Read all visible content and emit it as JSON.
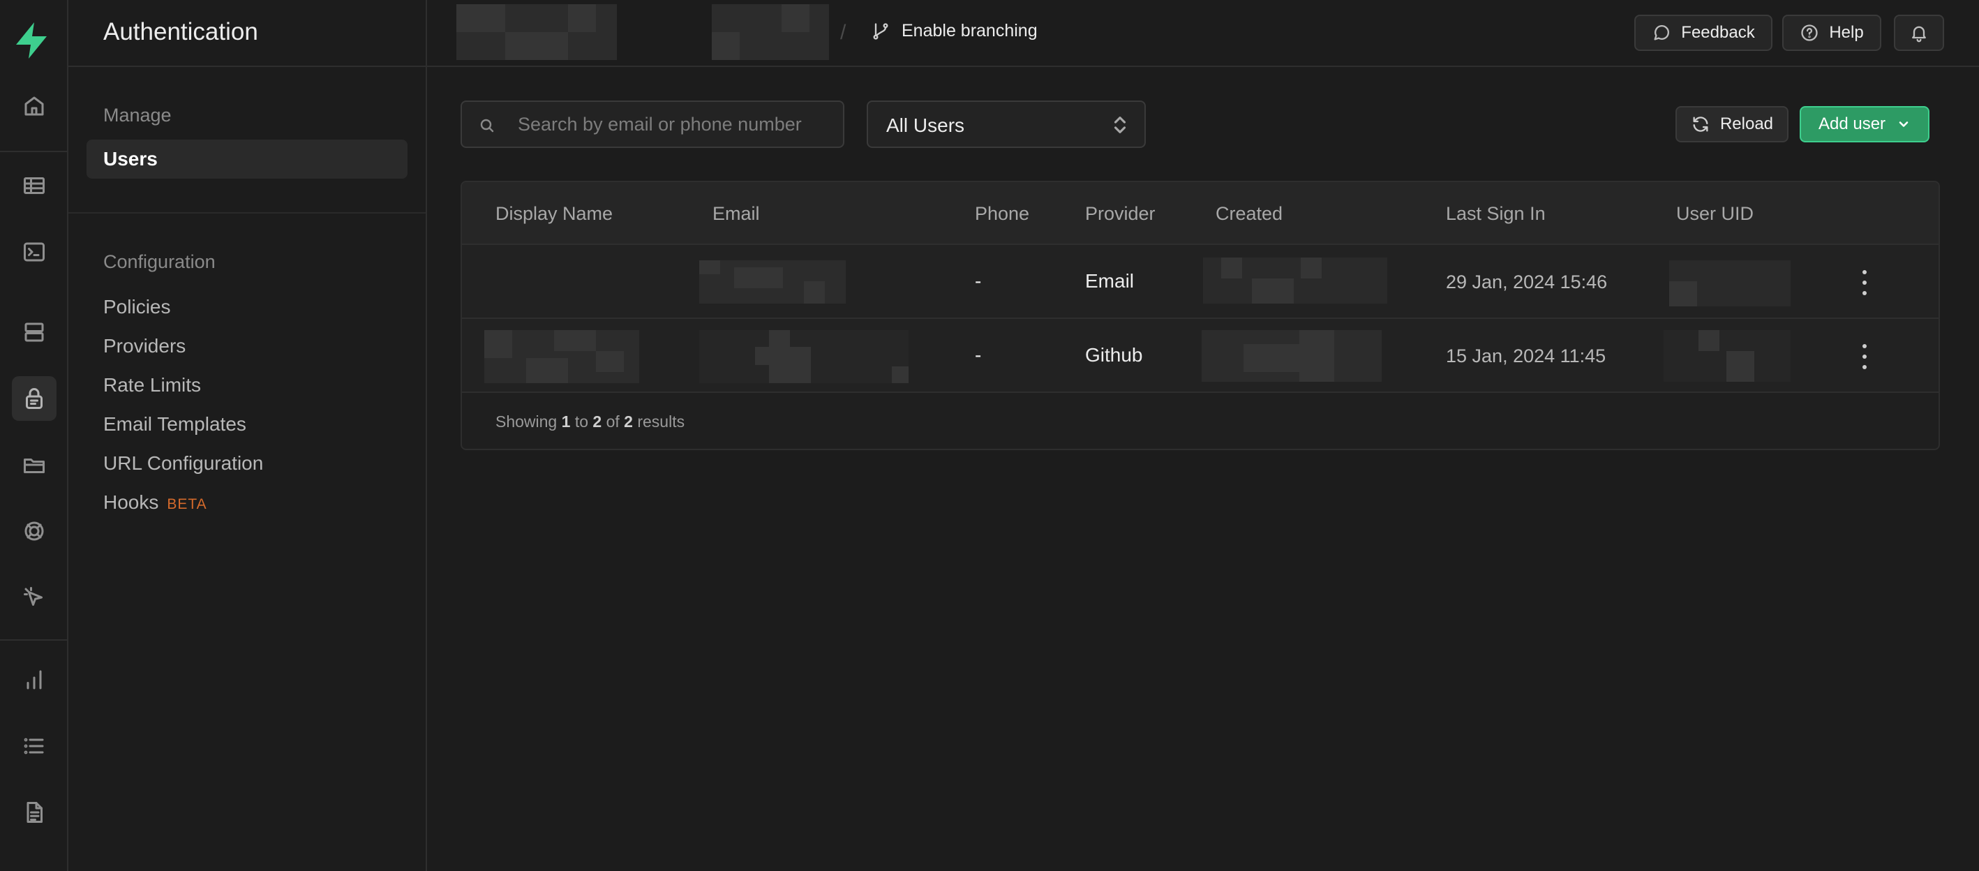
{
  "app": {
    "accent_color": "#3ecf8e",
    "rail_icons": [
      "supabase-logo",
      "home-icon",
      "table-editor-icon",
      "sql-editor-icon",
      "database-icon",
      "authentication-icon",
      "storage-icon",
      "realtime-icon",
      "edge-functions-icon",
      "reports-icon",
      "logs-icon",
      "api-docs-icon"
    ]
  },
  "sidebar": {
    "title": "Authentication",
    "manage_label": "Manage",
    "manage_items": [
      {
        "label": "Users",
        "active": true
      }
    ],
    "configuration_label": "Configuration",
    "config_items": [
      {
        "label": "Policies"
      },
      {
        "label": "Providers"
      },
      {
        "label": "Rate Limits"
      },
      {
        "label": "Email Templates"
      },
      {
        "label": "URL Configuration"
      },
      {
        "label": "Hooks",
        "badge": "BETA"
      }
    ]
  },
  "topbar": {
    "separator": "/",
    "branching_label": "Enable branching",
    "feedback_label": "Feedback",
    "help_label": "Help"
  },
  "toolbar": {
    "search_placeholder": "Search by email or phone number",
    "filter_value": "All Users",
    "reload_label": "Reload",
    "add_user_label": "Add user"
  },
  "table": {
    "columns": [
      "Display Name",
      "Email",
      "Phone",
      "Provider",
      "Created",
      "Last Sign In",
      "User UID"
    ],
    "rows": [
      {
        "phone": "-",
        "provider": "Email",
        "last_sign_in": "29 Jan, 2024 15:46"
      },
      {
        "phone": "-",
        "provider": "Github",
        "last_sign_in": "15 Jan, 2024 11:45"
      }
    ],
    "footer": {
      "prefix": "Showing",
      "from": "1",
      "to_word": "to",
      "to": "2",
      "of_word": "of",
      "total": "2",
      "suffix": "results"
    }
  }
}
